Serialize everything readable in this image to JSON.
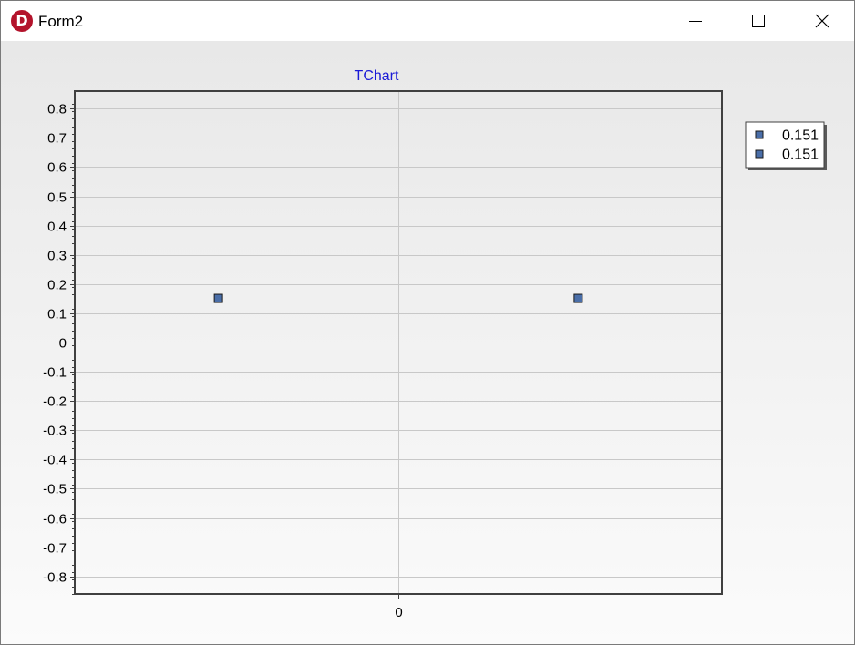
{
  "window": {
    "title": "Form2",
    "icon": "delphi-logo-icon",
    "buttons": [
      "minimize-icon",
      "maximize-icon",
      "close-icon"
    ]
  },
  "colors": {
    "title_text": "#1a1ad6",
    "point_fill": "#4a6ea8",
    "point_stroke": "#1a1a1a",
    "grid": "#c8c8c8"
  },
  "chart_data": {
    "type": "scatter",
    "title": "TChart",
    "xlabel": "",
    "ylabel": "",
    "x_ticks": [
      "0"
    ],
    "y_ticks": [
      "0.8",
      "0.7",
      "0.6",
      "0.5",
      "0.4",
      "0.3",
      "0.2",
      "0.1",
      "0",
      "-0.1",
      "-0.2",
      "-0.3",
      "-0.4",
      "-0.5",
      "-0.6",
      "-0.7",
      "-0.8"
    ],
    "xlim": [
      -1,
      1
    ],
    "ylim": [
      -0.86,
      0.86
    ],
    "grid": true,
    "legend_position": "right",
    "series": [
      {
        "name": "0.151",
        "points": [
          [
            -0.556,
            0.151
          ]
        ]
      },
      {
        "name": "0.151",
        "points": [
          [
            0.556,
            0.151
          ]
        ]
      }
    ]
  }
}
